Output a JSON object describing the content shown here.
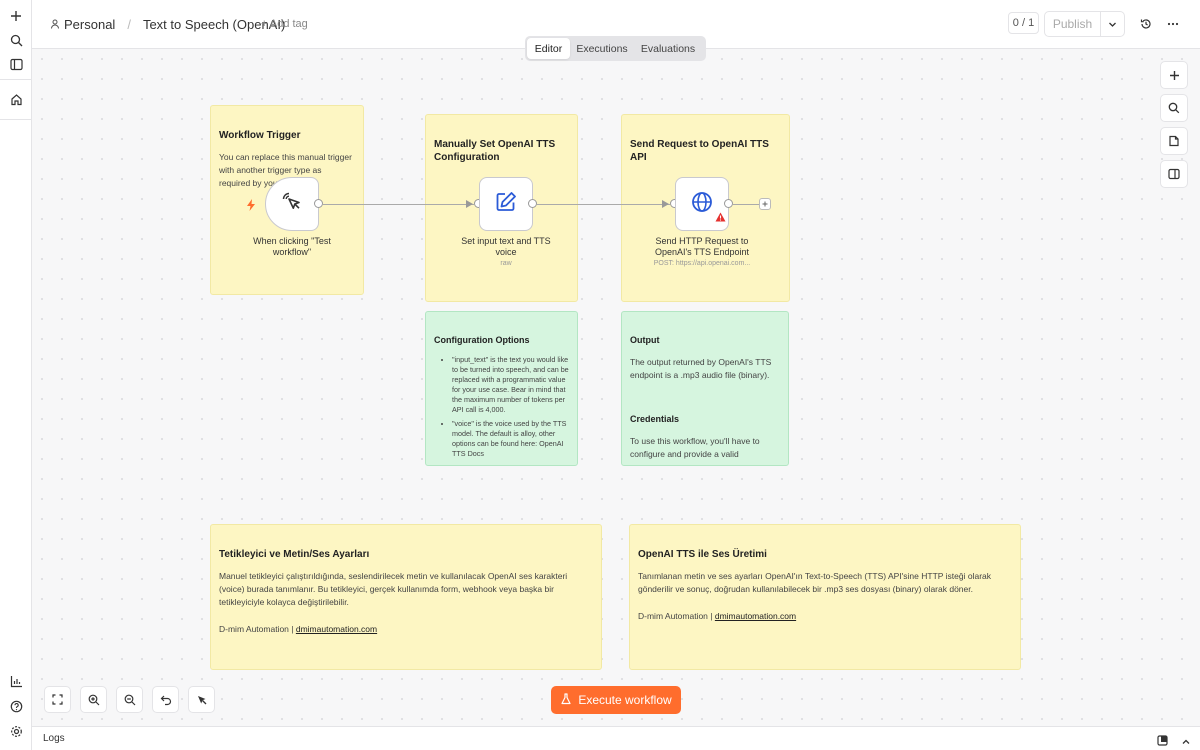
{
  "header": {
    "owner": "Personal",
    "workflow_name": "Text to Speech (OpenAI)",
    "add_tag": "+ Add tag",
    "counter": "0 / 1",
    "publish_label": "Publish"
  },
  "tabs": [
    {
      "label": "Editor",
      "active": true
    },
    {
      "label": "Executions",
      "active": false
    },
    {
      "label": "Evaluations",
      "active": false
    }
  ],
  "notes": {
    "workflow_trigger": {
      "title": "Workflow Trigger",
      "body": "You can replace this manual trigger with another trigger type as required by your use case."
    },
    "manual_set": {
      "title": "Manually Set OpenAI TTS Configuration"
    },
    "send_request": {
      "title": "Send Request to OpenAI TTS API"
    },
    "config_options": {
      "title": "Configuration Options",
      "items": [
        "\"input_text\" is the text you would like to be turned into speech, and can be replaced with a programmatic value for your use case. Bear in mind that the maximum number of tokens per API call is 4,000.",
        "\"voice\" is the voice used by the TTS model. The default is alloy, other options can be found here: OpenAI TTS Docs"
      ]
    },
    "output": {
      "title": "Output",
      "body": "The output returned by OpenAI's TTS endpoint is a .mp3 audio file (binary).",
      "title2": "Credentials",
      "body2": "To use this workflow, you'll have to configure and provide a valid"
    },
    "tetikleyici": {
      "title": "Tetikleyici ve Metin/Ses Ayarları",
      "body": "Manuel tetikleyici çalıştırıldığında, seslendirilecek metin ve kullanılacak OpenAI ses karakteri (voice) burada tanımlanır. Bu tetikleyici, gerçek kullanımda form, webhook veya başka bir tetikleyiciyle kolayca değiştirilebilir.",
      "footer_prefix": "D-mim Automation |",
      "footer_link": "dmimautomation.com"
    },
    "openai_tts": {
      "title": "OpenAI TTS ile Ses Üretimi",
      "body": "Tanımlanan metin ve ses ayarları OpenAI'ın Text-to-Speech (TTS) API'sine HTTP isteği olarak gönderilir ve sonuç, doğrudan kullanılabilecek bir .mp3 ses dosyası (binary) olarak döner.",
      "footer_prefix": "D-mim Automation |",
      "footer_link": "dmimautomation.com"
    }
  },
  "nodes": {
    "trigger": {
      "label": "When clicking \"Test workflow\""
    },
    "set": {
      "label": "Set input text and TTS voice",
      "sub": "raw"
    },
    "http": {
      "label": "Send HTTP Request to OpenAI's TTS Endpoint",
      "sub": "POST: https://api.openai.com..."
    }
  },
  "execute_label": "Execute workflow",
  "logs_label": "Logs",
  "colors": {
    "accent": "#ff6d2d",
    "sticky_yellow": "#fdf6c3",
    "sticky_green": "#d6f5df",
    "warning": "#e5312f"
  }
}
